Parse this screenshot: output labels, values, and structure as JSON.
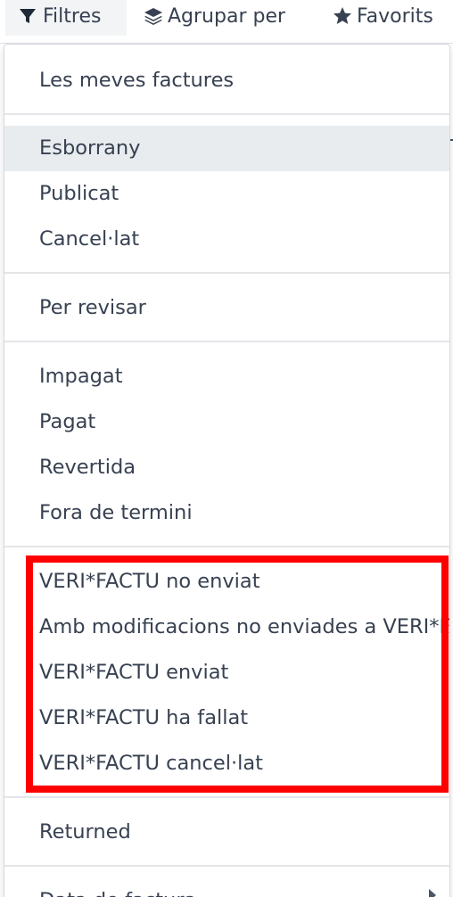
{
  "toolbar": {
    "filters_label": "Filtres",
    "groupby_label": "Agrupar per",
    "favorites_label": "Favorits",
    "filters_icon": "filter-icon",
    "groupby_icon": "layers-icon",
    "favorites_icon": "star-icon"
  },
  "menu": {
    "items": [
      {
        "label": "Les meves factures"
      },
      {
        "label": "Esborrany"
      },
      {
        "label": "Publicat"
      },
      {
        "label": "Cancel·lat"
      },
      {
        "label": "Per revisar"
      },
      {
        "label": "Impagat"
      },
      {
        "label": "Pagat"
      },
      {
        "label": "Revertida"
      },
      {
        "label": "Fora de termini"
      },
      {
        "label": "VERI*FACTU no enviat"
      },
      {
        "label": "Amb modificacions no enviades a VERI*FACTU"
      },
      {
        "label": "VERI*FACTU enviat"
      },
      {
        "label": "VERI*FACTU ha fallat"
      },
      {
        "label": "VERI*FACTU cancel·lat"
      },
      {
        "label": "Returned"
      },
      {
        "label": "Data de factura"
      }
    ]
  },
  "annotation": {
    "highlight_color": "#ff0000"
  }
}
